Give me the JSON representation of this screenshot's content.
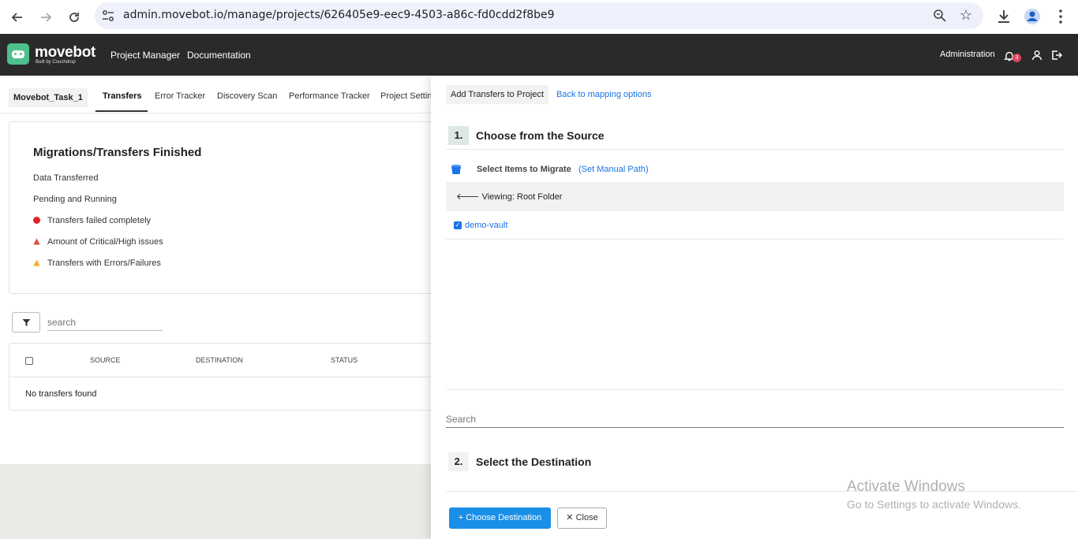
{
  "browser": {
    "url": "admin.movebot.io/manage/projects/626405e9-eec9-4503-a86c-fd0cdd2f8be9"
  },
  "header": {
    "brand": "movebot",
    "brand_sub": "Built by Couchdrop",
    "nav": [
      "Project Manager",
      "Documentation"
    ],
    "administration": "Administration",
    "notification_count": "3"
  },
  "project": {
    "name": "Movebot_Task_1",
    "tabs": [
      "Transfers",
      "Error Tracker",
      "Discovery Scan",
      "Performance Tracker",
      "Project Settings"
    ]
  },
  "summary": {
    "title": "Migrations/Transfers Finished",
    "stats": [
      "Data Transferred",
      "Pending and Running",
      "Transfers failed completely",
      "Amount of Critical/High issues",
      "Transfers with Errors/Failures"
    ]
  },
  "transfers": {
    "search_placeholder": "search",
    "columns": [
      "SOURCE",
      "DESTINATION",
      "STATUS"
    ],
    "empty_message": "No transfers found"
  },
  "drawer": {
    "title_button": "Add Transfers to Project",
    "back_link": "Back to mapping options",
    "step1": {
      "num": "1.",
      "title": "Choose from the Source"
    },
    "select_items": "Select Items to Migrate",
    "manual_path_open": "(",
    "manual_path": "Set Manual Path",
    "manual_path_close": ")",
    "viewing": "Viewing: Root Folder",
    "items": [
      "demo-vault"
    ],
    "search_placeholder": "Search",
    "step2": {
      "num": "2.",
      "title": "Select the Destination"
    },
    "choose_destination": "Choose Destination",
    "close": "Close"
  },
  "watermark": {
    "line1": "Activate Windows",
    "line2": "Go to Settings to activate Windows."
  }
}
